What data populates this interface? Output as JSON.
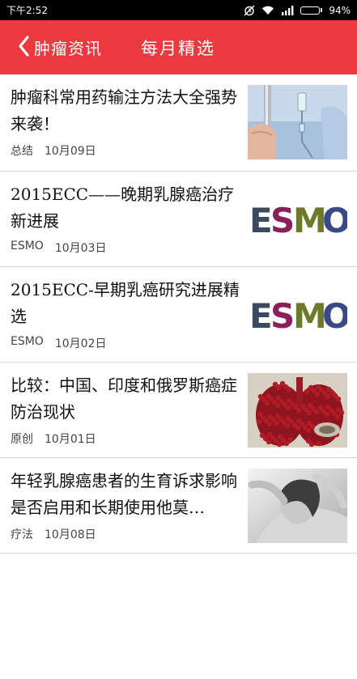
{
  "status_bar": {
    "time": "下午2:52",
    "battery": "94%",
    "battery_level": 0.94
  },
  "app_bar": {
    "back_label": "肿瘤资讯",
    "title": "每月精选"
  },
  "articles": [
    {
      "title": "肿瘤科常用药输注方法大全强势来袭！",
      "tag": "总结",
      "date": "10月09日",
      "thumb": "iv-drip-image"
    },
    {
      "title": "2015ECC——晚期乳腺癌治疗新进展",
      "tag": "ESMO",
      "date": "10月03日",
      "thumb": "esmo-logo"
    },
    {
      "title": "2015ECC-早期乳癌研究进展精选",
      "tag": "ESMO",
      "date": "10月02日",
      "thumb": "esmo-logo"
    },
    {
      "title": "比较：中国、印度和俄罗斯癌症防治现状",
      "tag": "原创",
      "date": "10月01日",
      "thumb": "lungs-image"
    },
    {
      "title": "年轻乳腺癌患者的生育诉求影响是否启用和长期使用他莫…",
      "tag": "疗法",
      "date": "10月08日",
      "thumb": "woman-photo"
    }
  ],
  "esmo_logo": {
    "text": "ESMO",
    "letters": [
      "E",
      "S",
      "M",
      "O"
    ],
    "colors": [
      "#3b4a5e",
      "#8b1f5a",
      "#6e7a2a",
      "#3a4a86"
    ]
  },
  "colors": {
    "accent": "#ea3a3f"
  }
}
